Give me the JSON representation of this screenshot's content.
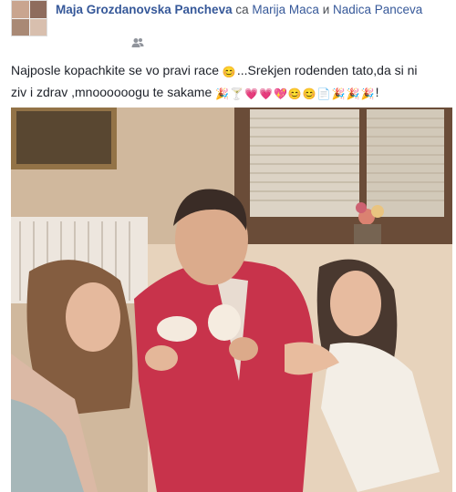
{
  "post": {
    "author": "Maja Grozdanovska Pancheva",
    "with_label": "са",
    "tagged_first": "Marija Maca",
    "conjunction": "и",
    "tagged_second": "Nadica Panceva",
    "audience_icon": "friends-icon",
    "text_line1": "Najposle kopachkite se vo pravi race",
    "text_line1_rest": "...Srekjen rodenden tato,da si ni",
    "text_line2": "ziv i zdrav ,mnoooooogu te sakame",
    "text_line2_end": "!",
    "emojis_line1": [
      "😊"
    ],
    "emojis_line2": [
      "🎉",
      "🍸",
      "💗",
      "💗",
      "💖",
      "😊",
      "😊",
      "📄",
      "🎉",
      "🎉",
      "🎉"
    ]
  },
  "photo": {
    "description_icon": "photo",
    "accent_colors": {
      "wall": "#d9c3a8",
      "shirt": "#c8203a",
      "window": "#6b4a34",
      "couch": "#e8d6bf"
    }
  }
}
